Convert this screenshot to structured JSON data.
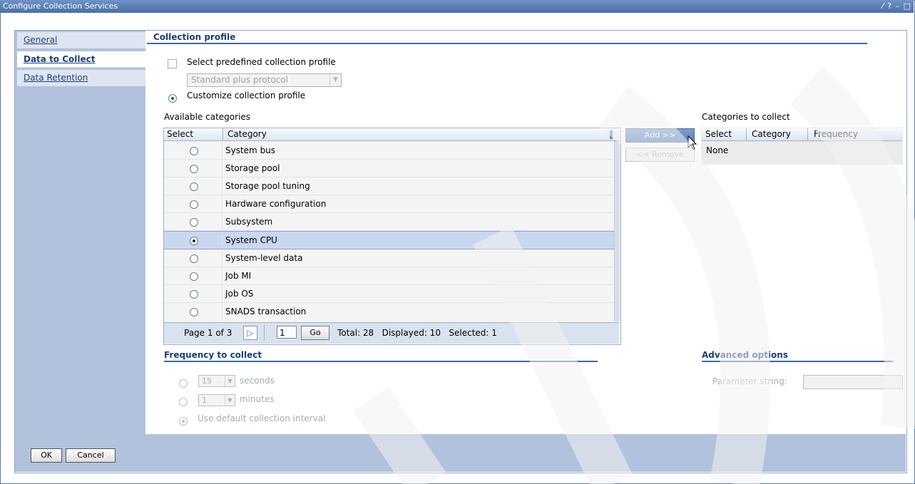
{
  "window": {
    "title": "Configure Collection Services",
    "controls": "⁄ ? – □"
  },
  "sidebar": {
    "items": [
      {
        "label": "General"
      },
      {
        "label": "Data to Collect"
      },
      {
        "label": "Data Retention"
      }
    ]
  },
  "collection_profile": {
    "heading": "Collection profile",
    "predefined_label": "Select predefined collection profile",
    "predefined_value": "Standard plus protocol",
    "customize_label": "Customize collection profile"
  },
  "available": {
    "label": "Available categories",
    "col_select": "Select",
    "col_category": "Category",
    "rows": [
      {
        "category": "System bus",
        "selected": false
      },
      {
        "category": "Storage pool",
        "selected": false
      },
      {
        "category": "Storage pool tuning",
        "selected": false
      },
      {
        "category": "Hardware configuration",
        "selected": false
      },
      {
        "category": "Subsystem",
        "selected": false
      },
      {
        "category": "System CPU",
        "selected": true
      },
      {
        "category": "System-level data",
        "selected": false
      },
      {
        "category": "Job MI",
        "selected": false
      },
      {
        "category": "Job OS",
        "selected": false
      },
      {
        "category": "SNADS transaction",
        "selected": false
      }
    ],
    "pager": {
      "page_text": "Page 1 of 3",
      "page_input": "1",
      "go_label": "Go",
      "summary": "Total: 28   Displayed: 10   Selected: 1"
    }
  },
  "buttons": {
    "add": "Add >>",
    "remove": "<< Remove"
  },
  "to_collect": {
    "label": "Categories to collect",
    "col_select": "Select",
    "col_category": "Category",
    "col_frequency": "Frequency",
    "empty": "None"
  },
  "frequency": {
    "heading": "Frequency to collect",
    "seconds_value": "15",
    "seconds_label": "seconds",
    "minutes_value": "1",
    "minutes_label": "minutes",
    "default_label": "Use default collection interval"
  },
  "advanced": {
    "heading": "Advanced options",
    "param_label": "Parameter string:"
  },
  "footer": {
    "ok": "OK",
    "cancel": "Cancel"
  }
}
